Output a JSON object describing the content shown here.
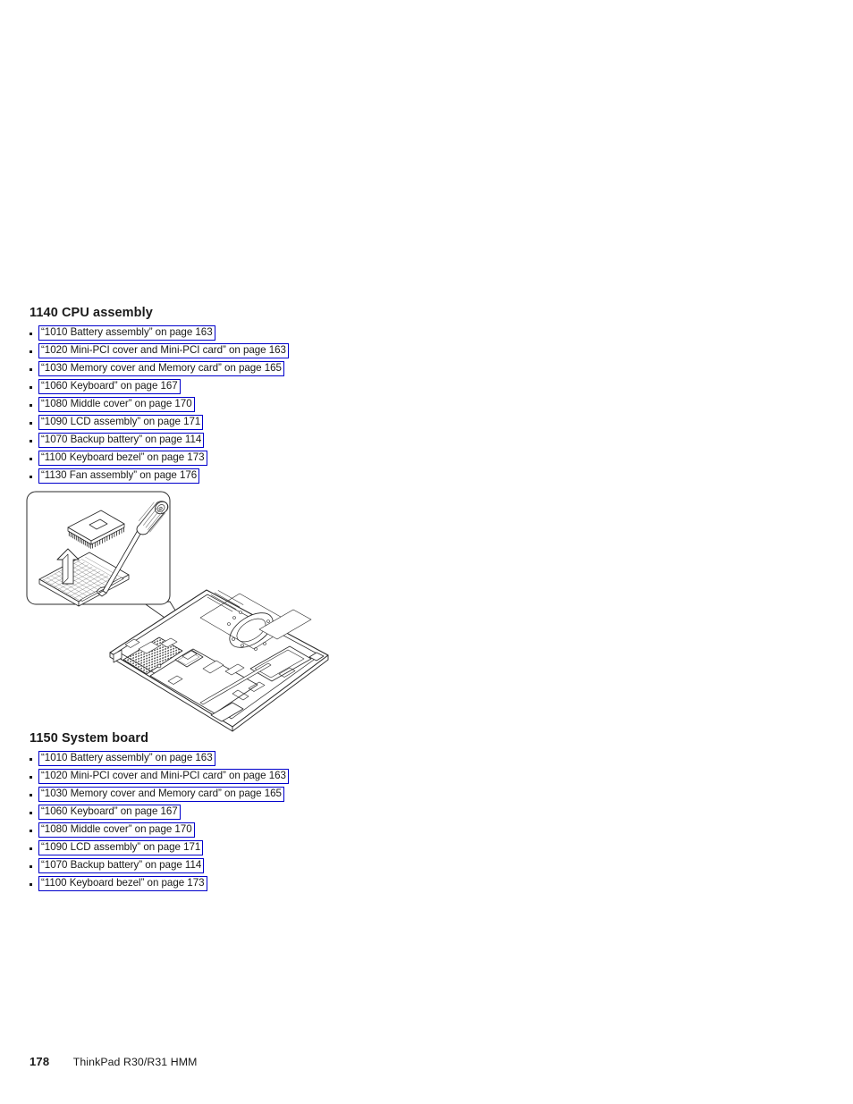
{
  "document": {
    "product": "ThinkPad R30/R31 HMM"
  },
  "sections": [
    {
      "heading": "1140 CPU assembly",
      "items": [
        "“1010 Battery assembly” on page 163",
        "“1020 Mini-PCI cover and Mini-PCI card” on page 163",
        "“1030 Memory cover and Memory card” on page 165",
        "“1060 Keyboard” on page 167",
        "“1080 Middle cover” on page 170",
        "“1090 LCD assembly” on page 171",
        "“1070 Backup battery” on page 114",
        "“1100 Keyboard bezel” on page 173",
        "“1130 Fan assembly” on page 176"
      ]
    },
    {
      "heading": "1150 System board",
      "items": [
        "“1010 Battery assembly” on page 163",
        "“1020 Mini-PCI cover and Mini-PCI card” on page 163",
        "“1030 Memory cover and Memory card” on page 165",
        "“1060 Keyboard” on page 167",
        "“1080 Middle cover” on page 170",
        "“1090 LCD assembly” on page 171",
        "“1070 Backup battery” on page 114",
        "“1100 Keyboard bezel” on page 173"
      ]
    }
  ],
  "figure": {
    "caption_elements": [
      "callout-bubble",
      "cpu-chip",
      "cpu-socket",
      "screwdriver",
      "lift-arrow",
      "laptop-base-chassis"
    ]
  },
  "footer": {
    "page_number": "178",
    "title": "ThinkPad R30/R31 HMM"
  },
  "colors": {
    "link_border": "#0000cc",
    "text": "#1a1a1a",
    "page_background": "#ffffff",
    "line_art": "#2b2b2b"
  }
}
